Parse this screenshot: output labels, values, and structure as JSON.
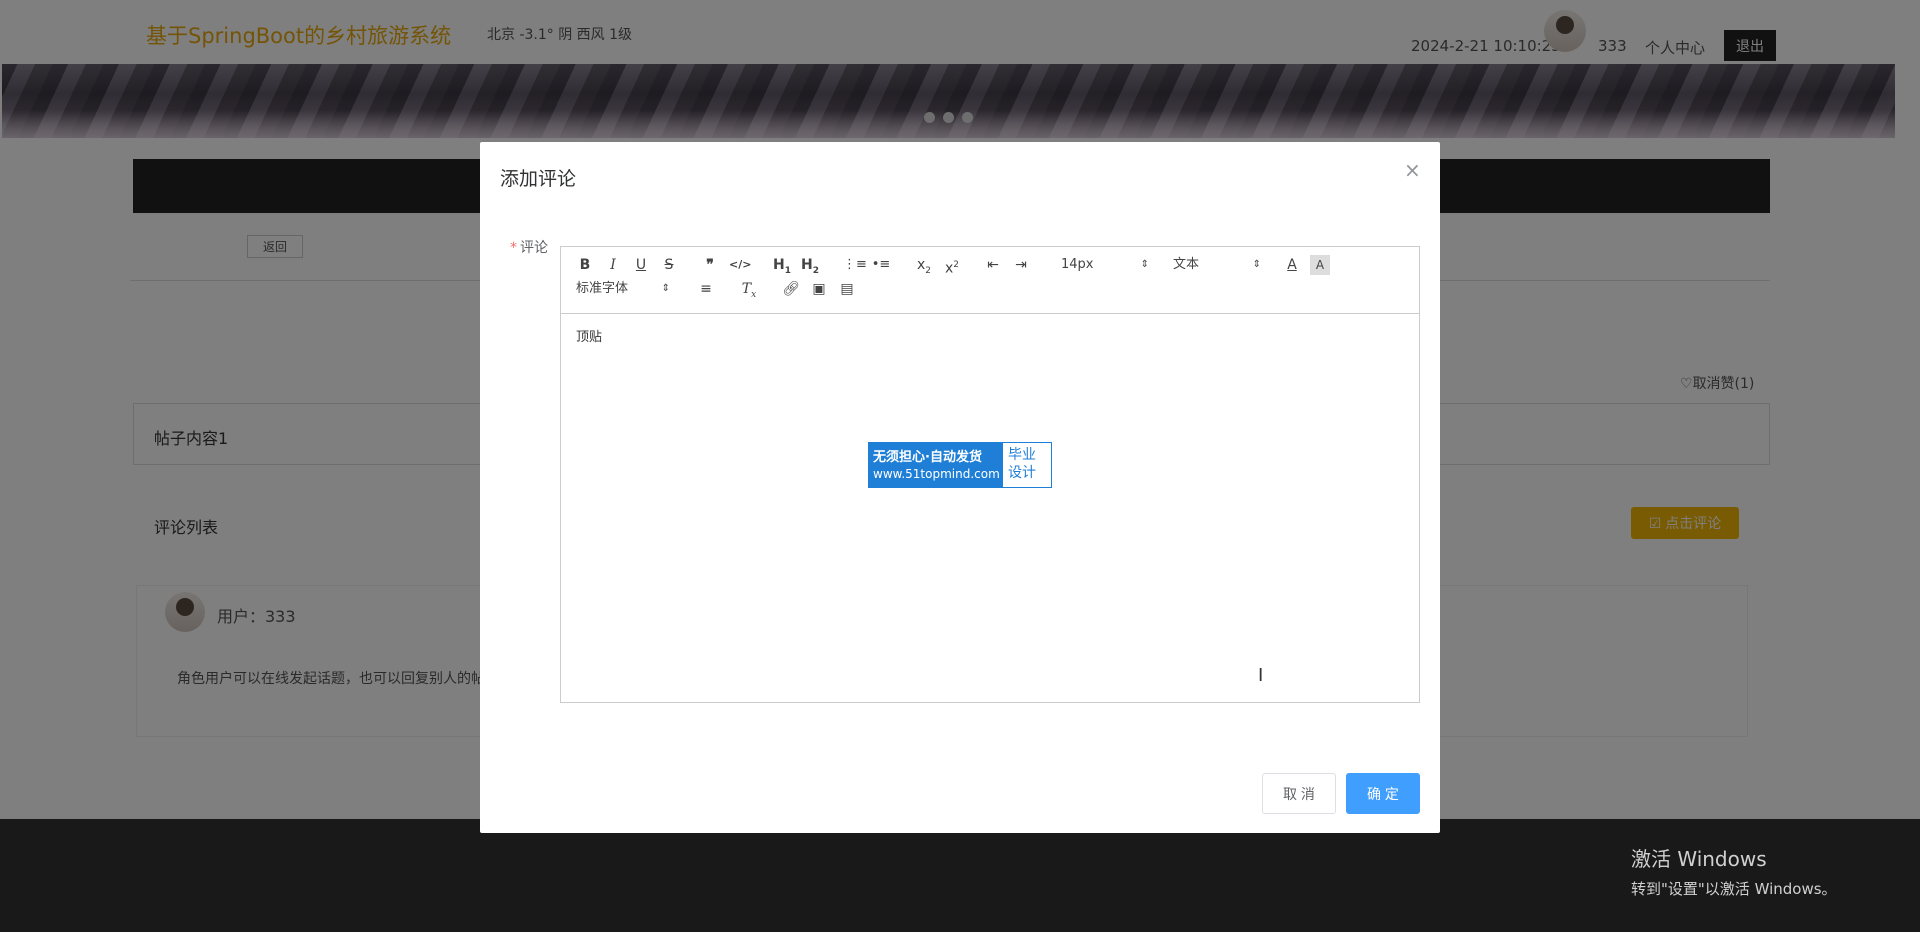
{
  "header": {
    "site_title": "基于SpringBoot的乡村旅游系统",
    "weather": "北京  -3.1°  阴  西风  1级",
    "datetime": "2024-2-21 10:10:25",
    "username": "333",
    "personal_center": "个人中心",
    "logout": "退出"
  },
  "banner": {
    "dots": 3,
    "active_dot": 0
  },
  "page": {
    "back": "返回",
    "unlike": "取消赞(1)",
    "post_content": "帖子内容1",
    "comment_list_title": "评论列表",
    "add_comment_btn": "点击评论",
    "comment": {
      "user": "用户：333",
      "text": "角色用户可以在线发起话题，也可以回复别人的帖"
    }
  },
  "dialog": {
    "title": "添加评论",
    "field_label": "评论",
    "editor_toolbar": {
      "font_size": "14px",
      "block_type": "文本",
      "font_family": "标准字体"
    },
    "editor_content": "顶贴",
    "cancel": "取 消",
    "confirm": "确 定"
  },
  "watermark": {
    "line1": "无须担心·自动发货",
    "line2": "www.51topmind.com",
    "right": "毕业设计"
  },
  "windows": {
    "title": "激活 Windows",
    "subtitle": "转到\"设置\"以激活 Windows。"
  },
  "colors": {
    "brand": "#e8a80c",
    "primary": "#409eff",
    "comment_button": "#f3b707"
  }
}
